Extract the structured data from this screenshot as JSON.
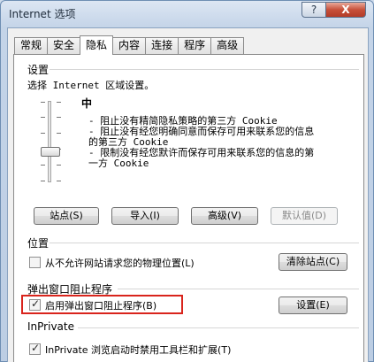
{
  "window": {
    "title": "Internet 选项",
    "help_glyph": "?",
    "close_glyph": "X"
  },
  "tabs": [
    {
      "label": "常规"
    },
    {
      "label": "安全"
    },
    {
      "label": "隐私",
      "active": true
    },
    {
      "label": "内容"
    },
    {
      "label": "连接"
    },
    {
      "label": "程序"
    },
    {
      "label": "高级"
    }
  ],
  "settings": {
    "group_label": "设置",
    "instruction": "选择 Internet 区域设置。",
    "level_label": "中",
    "desc_lines": [
      "- 阻止没有精简隐私策略的第三方 Cookie",
      "- 阻止没有经您明确同意而保存可用来联系您的信息",
      "的第三方 Cookie",
      "- 限制没有经您默许而保存可用来联系您的信息的第",
      "一方 Cookie"
    ],
    "buttons": {
      "sites": "站点(S)",
      "import": "导入(I)",
      "advanced": "高级(V)",
      "default": "默认值(D)"
    }
  },
  "location": {
    "group_label": "位置",
    "checkbox_label": "从不允许网站请求您的物理位置(L)",
    "clear_button": "清除站点(C)"
  },
  "popup": {
    "group_label": "弹出窗口阻止程序",
    "checkbox_label": "启用弹出窗口阻止程序(B)",
    "settings_button": "设置(E)"
  },
  "inprivate": {
    "group_label": "InPrivate",
    "checkbox_label": "InPrivate 浏览启动时禁用工具栏和扩展(T)"
  }
}
